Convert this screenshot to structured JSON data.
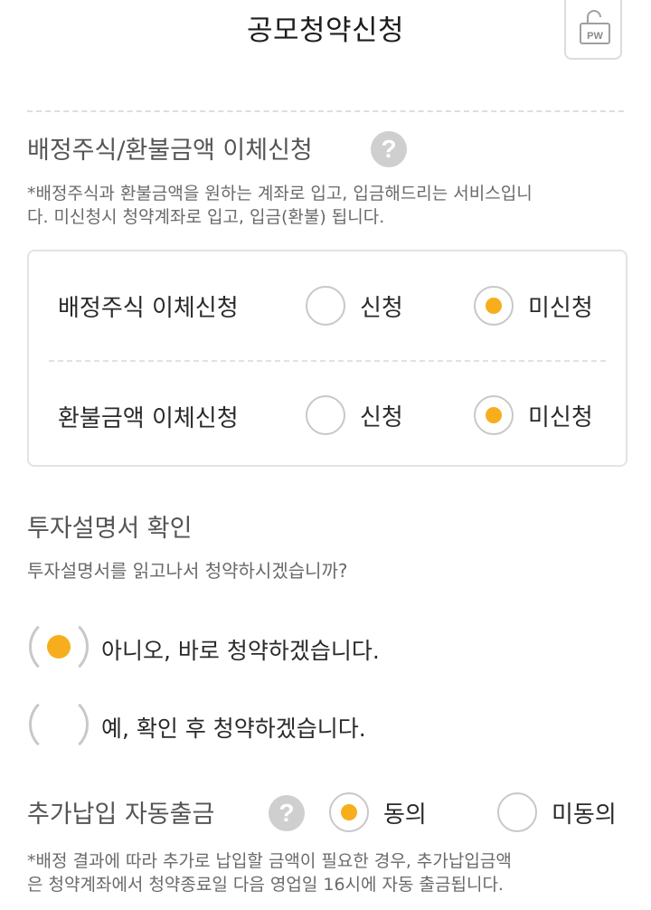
{
  "header": {
    "title": "공모청약신청",
    "pw_button_label": "PW"
  },
  "transfer": {
    "title": "배정주식/환불금액 이체신청",
    "help": "?",
    "note_line1": "*배정주식과 환불금액을 원하는 계좌로 입고, 입금해드리는 서비스입니",
    "note_line2": "다. 미신청시 청약계좌로 입고, 입금(환불) 됩니다.",
    "rows": [
      {
        "label": "배정주식 이체신청",
        "options": [
          {
            "label": "신청",
            "checked": false
          },
          {
            "label": "미신청",
            "checked": true
          }
        ]
      },
      {
        "label": "환불금액 이체신청",
        "options": [
          {
            "label": "신청",
            "checked": false
          },
          {
            "label": "미신청",
            "checked": true
          }
        ]
      }
    ]
  },
  "prospectus": {
    "title": "투자설명서 확인",
    "question": "투자설명서를 읽고나서 청약하시겠습니까?",
    "options": [
      {
        "label": "아니오, 바로 청약하겠습니다.",
        "checked": true
      },
      {
        "label": "예, 확인 후 청약하겠습니다.",
        "checked": false
      }
    ]
  },
  "auto_withdraw": {
    "title": "추가납입 자동출금",
    "help": "?",
    "options": [
      {
        "label": "동의",
        "checked": true
      },
      {
        "label": "미동의",
        "checked": false
      }
    ],
    "note_line1": "*배정 결과에 따라 추가로 납입할 금액이 필요한 경우, 추가납입금액",
    "note_line2": "은 청약계좌에서 청약종료일 다음 영업일 16시에 자동 출금됩니다."
  },
  "colors": {
    "accent": "#f7ae1d",
    "border": "#e3e3e3",
    "help_bg": "#cfcfcf"
  }
}
